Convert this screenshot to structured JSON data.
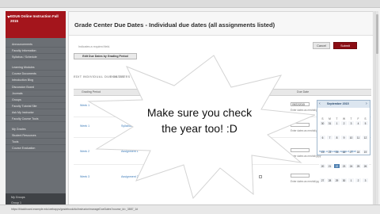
{
  "sidebar": {
    "course_title": "EDU6 Online Instruction Fall 2015",
    "items": [
      "Announcements",
      "Faculty Information",
      "Syllabus / Schedule",
      "Learning Modules",
      "Course Documents",
      "Introduction Blog",
      "Discussion Board",
      "Journals",
      "Groups",
      "Faculty Tutorial Site",
      "Ask My Instructor",
      "Faculty Course Tools",
      "My Grades",
      "Student Resources",
      "Tools",
      "Course Evaluation"
    ],
    "footer_label": "My Groups",
    "footer_sub": "Group 1"
  },
  "header": {
    "title": "Grade Center Due Dates - Individual due dates (all assignments listed)",
    "cancel_label": "Cancel",
    "submit_label": "Submit",
    "instructions": "Indicates a required field.",
    "edit_grading_label": "Edit Due Dates by Grading Period"
  },
  "sections": {
    "edit": "EDIT INDIVIDUAL DUE DATES",
    "due": "DUE DATES"
  },
  "grid": {
    "columns": [
      "Grading Period",
      "Due Date"
    ]
  },
  "rows": [
    {
      "item": "Week 1",
      "title": "Syllabus Quiz",
      "type": "",
      "hint": "Enter dates as mm/dd/yyyy",
      "date": "09/22/2015"
    },
    {
      "item": "Week 1",
      "title": "Syllabus Quiz",
      "type": "",
      "hint": "Enter dates as mm/dd/yyyy",
      "date": ""
    },
    {
      "item": "Week 2",
      "title": "Assignment 1",
      "type": "Discussion",
      "hint": "Enter dates as mm/dd/yyyy",
      "date": ""
    },
    {
      "item": "Week 3",
      "title": "Assignment 2",
      "type": "Discussion",
      "hint": "Enter dates as mm/dd/yyyy",
      "date": ""
    }
  ],
  "calendar": {
    "title": "September 2015",
    "days": [
      "S",
      "M",
      "T",
      "W",
      "T",
      "F",
      "S"
    ],
    "cells": [
      "30",
      "31",
      "1",
      "2",
      "3",
      "4",
      "5",
      "6",
      "7",
      "8",
      "9",
      "10",
      "11",
      "12",
      "13",
      "14",
      "15",
      "16",
      "17",
      "18",
      "19",
      "20",
      "21",
      "22",
      "23",
      "24",
      "25",
      "26",
      "27",
      "28",
      "29",
      "30",
      "1",
      "2",
      "3"
    ],
    "today_index": 23,
    "footer": "Today is: Thursday, August 6, 2015"
  },
  "callout": {
    "line1": "Make sure you check",
    "line2": "the year too! :D"
  },
  "status_url": "https://blackboard.example.edu/webapps/gradebook/do/instructor/manageDueDates?course_id=_3887_1#",
  "colors": {
    "brand_red": "#a4151c",
    "submit": "#8b0d14",
    "sidebar": "#6b6f74",
    "starburst": "#ffffff"
  }
}
